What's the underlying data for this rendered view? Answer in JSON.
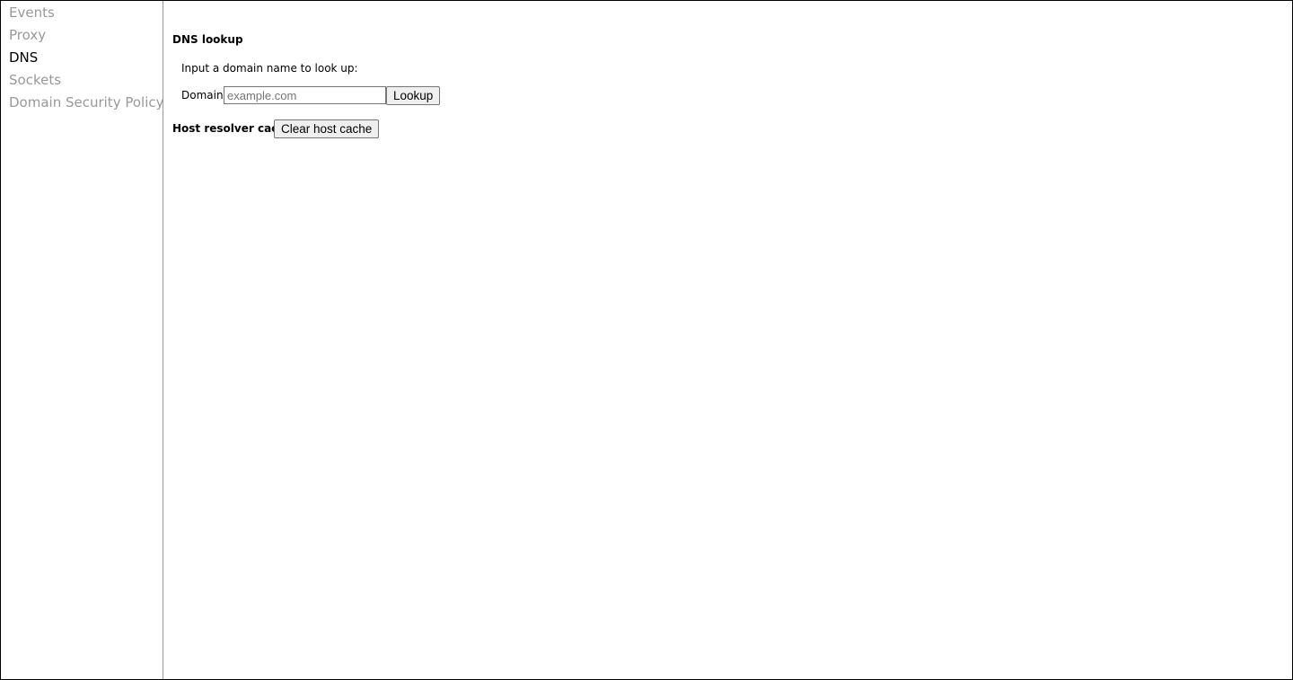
{
  "sidebar": {
    "items": [
      {
        "label": "Events",
        "active": false
      },
      {
        "label": "Proxy",
        "active": false
      },
      {
        "label": "DNS",
        "active": true
      },
      {
        "label": "Sockets",
        "active": false
      },
      {
        "label": "Domain Security Policy",
        "active": false
      }
    ]
  },
  "dns": {
    "title": "DNS lookup",
    "hint": "Input a domain name to look up:",
    "domain_label": "Domain:",
    "domain_value": "",
    "domain_placeholder": "example.com",
    "lookup_label": "Lookup",
    "cache_title": "Host resolver cache",
    "clear_label": "Clear host cache"
  }
}
